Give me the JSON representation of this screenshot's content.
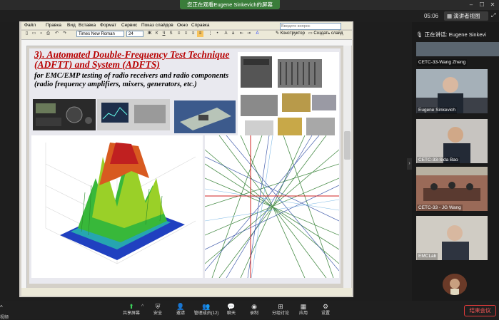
{
  "meeting": {
    "share_banner": "您正在观看Eugene Sinkevich的屏幕",
    "clock": "05:06",
    "speaker_view": "演讲者视图",
    "now_speaking": "正在讲话: Eugene Sinkevi",
    "end_button": "结束会议"
  },
  "word": {
    "menu": [
      "Файл",
      "Правка",
      "Вид",
      "Вставка",
      "Формат",
      "Сервис",
      "Показ слайдов",
      "Окно",
      "Справка"
    ],
    "search_placeholder": "Введите вопрос",
    "font_name": "Times New Roman",
    "font_size": "24",
    "constructor_label": "Конструктор",
    "new_slide_label": "Создать слайд"
  },
  "slide": {
    "title": "3). Automated Double-Frequency Test Technique (ADFTT) and System (ADFTS)",
    "subtitle": "for EMC/EMP testing of radio receivers and radio components (radio frequency amplifiers, mixers, generators, etc.)"
  },
  "participants": [
    {
      "name": "CETC-33-Wang Zheng"
    },
    {
      "name": "Eugene Sinkevich"
    },
    {
      "name": "CETC-33-Sida Bao"
    },
    {
      "name": "CETC-33 - JG Wang"
    },
    {
      "name": "EMCLab"
    }
  ],
  "toolbar": [
    {
      "label": "共享屏幕",
      "icon": "share-screen-icon"
    },
    {
      "label": "安全",
      "icon": "shield-icon"
    },
    {
      "label": "邀请",
      "icon": "invite-icon"
    },
    {
      "label": "管理成员(12)",
      "icon": "participants-icon"
    },
    {
      "label": "聊天",
      "icon": "chat-icon"
    },
    {
      "label": "录制",
      "icon": "record-icon"
    },
    {
      "label": "分组讨论",
      "icon": "breakout-icon"
    },
    {
      "label": "应用",
      "icon": "apps-icon"
    },
    {
      "label": "设置",
      "icon": "gear-icon"
    }
  ],
  "left_edge_label": "视频"
}
